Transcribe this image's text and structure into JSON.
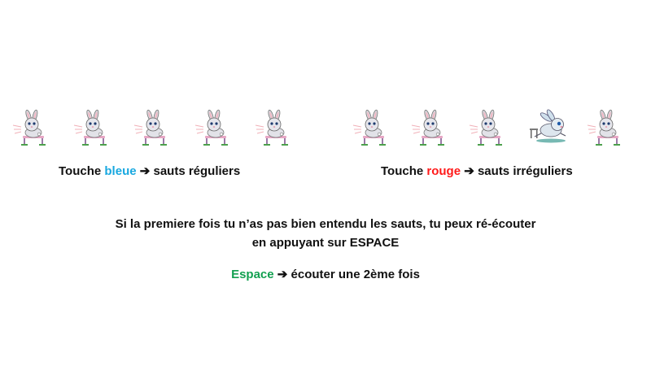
{
  "rows": {
    "left_bunnies": [
      "bunny-hurdle-icon",
      "bunny-hurdle-icon",
      "bunny-hurdle-icon",
      "bunny-hurdle-icon",
      "bunny-hurdle-icon"
    ],
    "right_bunnies": [
      "bunny-hurdle-icon",
      "bunny-hurdle-icon",
      "bunny-hurdle-icon",
      "bunny-jumping-icon",
      "bunny-hurdle-icon"
    ]
  },
  "instructions": {
    "left": {
      "prefix": "Touche ",
      "color_word": "bleue",
      "arrow": " ➔ ",
      "suffix": "sauts réguliers",
      "color": "#18a8e0"
    },
    "right": {
      "prefix": "Touche ",
      "color_word": "rouge",
      "arrow": " ➔ ",
      "suffix": "sauts irréguliers",
      "color": "#ff1a1a"
    },
    "replay_line1": "Si la premiere fois tu n’as pas bien entendu les sauts, tu peux ré-écouter",
    "replay_line2": "en appuyant sur ESPACE",
    "space": {
      "key": "Espace",
      "arrow": " ➔ ",
      "suffix": "écouter une 2ème fois",
      "color": "#12a050"
    }
  }
}
